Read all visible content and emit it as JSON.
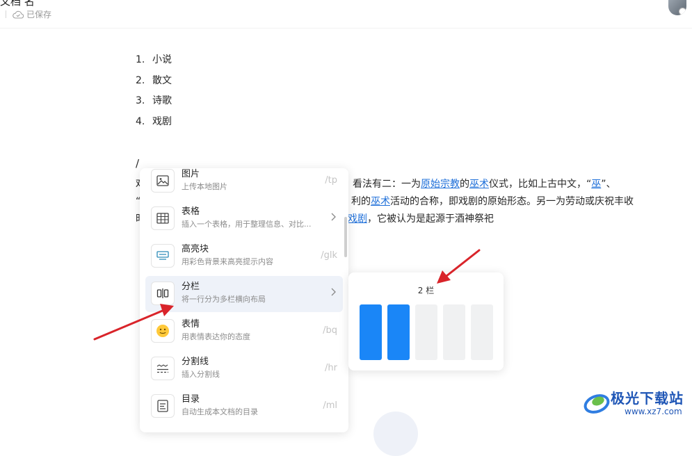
{
  "header": {
    "title": "文档 名",
    "save_status": "已保存"
  },
  "list": {
    "items": [
      {
        "num": "1.",
        "text": "小说"
      },
      {
        "num": "2.",
        "text": "散文"
      },
      {
        "num": "3.",
        "text": "诗歌"
      },
      {
        "num": "4.",
        "text": "戏剧"
      }
    ]
  },
  "slash": "/",
  "paragraph": {
    "l1_start": "戏",
    "l1_a": "看法有二：一为",
    "l1_link1": "原始宗教",
    "l1_b": "的",
    "l1_link2": "巫术",
    "l1_c": "仪式，比如上古中文，“",
    "l1_link3": "巫",
    "l1_d": "”、",
    "l2_start": "“",
    "l2_a": "利的",
    "l2_link": "巫术",
    "l2_b": "活动的合称，即戏剧的原始形态。另一为劳动或庆祝丰收",
    "l3_start": "时",
    "l3_link": "戏剧",
    "l3_b": "，它被认为是起源于酒神祭祀"
  },
  "menu": {
    "items": [
      {
        "title": "图片",
        "desc": "上传本地图片",
        "shortcut": "/tp",
        "icon": "image-icon"
      },
      {
        "title": "表格",
        "desc": "插入一个表格，用于整理信息、对比...",
        "shortcut": "",
        "icon": "table-icon"
      },
      {
        "title": "高亮块",
        "desc": "用彩色背景来高亮提示内容",
        "shortcut": "/glk",
        "icon": "highlight-block-icon"
      },
      {
        "title": "分栏",
        "desc": "将一行分为多栏横向布局",
        "shortcut": "",
        "icon": "columns-icon"
      },
      {
        "title": "表情",
        "desc": "用表情表达你的态度",
        "shortcut": "/bq",
        "icon": "emoji-icon"
      },
      {
        "title": "分割线",
        "desc": "插入分割线",
        "shortcut": "/hr",
        "icon": "divider-icon"
      },
      {
        "title": "目录",
        "desc": "自动生成本文档的目录",
        "shortcut": "/ml",
        "icon": "toc-icon"
      }
    ]
  },
  "columns_popover": {
    "label": "2 栏",
    "selected": 2,
    "total": 5
  },
  "watermark": {
    "name": "极光下载站",
    "url": "www.xz7.com"
  },
  "colors": {
    "accent": "#1a86f7",
    "link": "#1e6fd9",
    "arrow": "#d9242a",
    "menu_active_bg": "#eef2f9"
  }
}
